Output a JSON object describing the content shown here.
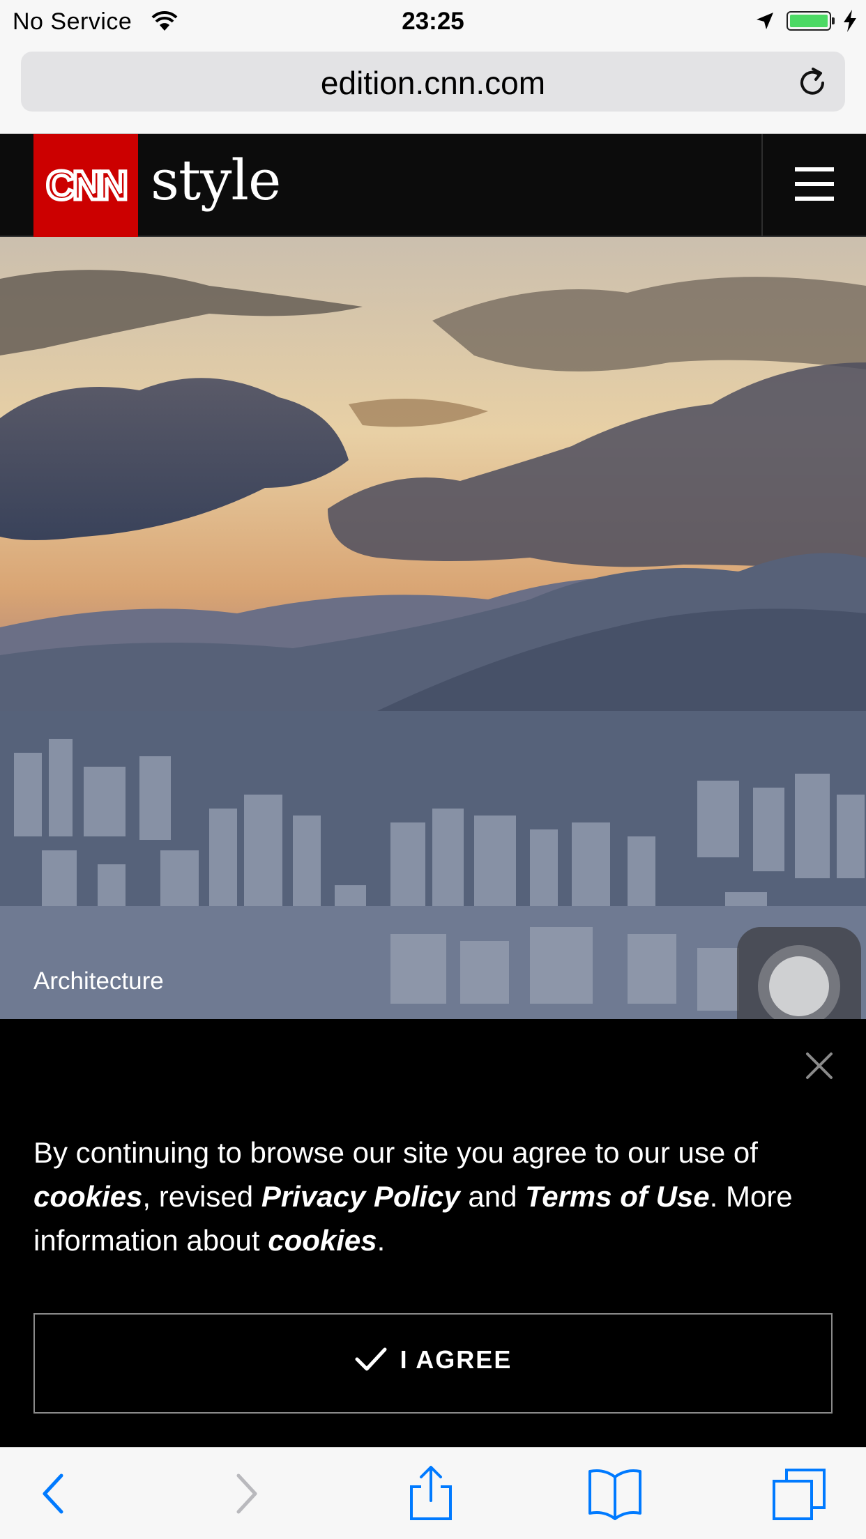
{
  "status_bar": {
    "carrier": "No Service",
    "time": "23:25"
  },
  "browser": {
    "url": "edition.cnn.com"
  },
  "site": {
    "logo_text": "CNN",
    "section": "style"
  },
  "hero": {
    "label": "Architecture"
  },
  "cookie_banner": {
    "text_1": "By continuing to browse our site you agree to our use of ",
    "link_cookies": "cookies",
    "text_2": ", revised ",
    "link_privacy": "Privacy Policy",
    "text_3": " and ",
    "link_terms": "Terms of Use",
    "text_4": ". More information about ",
    "link_cookies_2": "cookies",
    "text_5": ".",
    "agree_label": "I AGREE"
  },
  "colors": {
    "cnn_red": "#cc0000",
    "ios_blue": "#007aff",
    "battery_green": "#4cd964"
  }
}
